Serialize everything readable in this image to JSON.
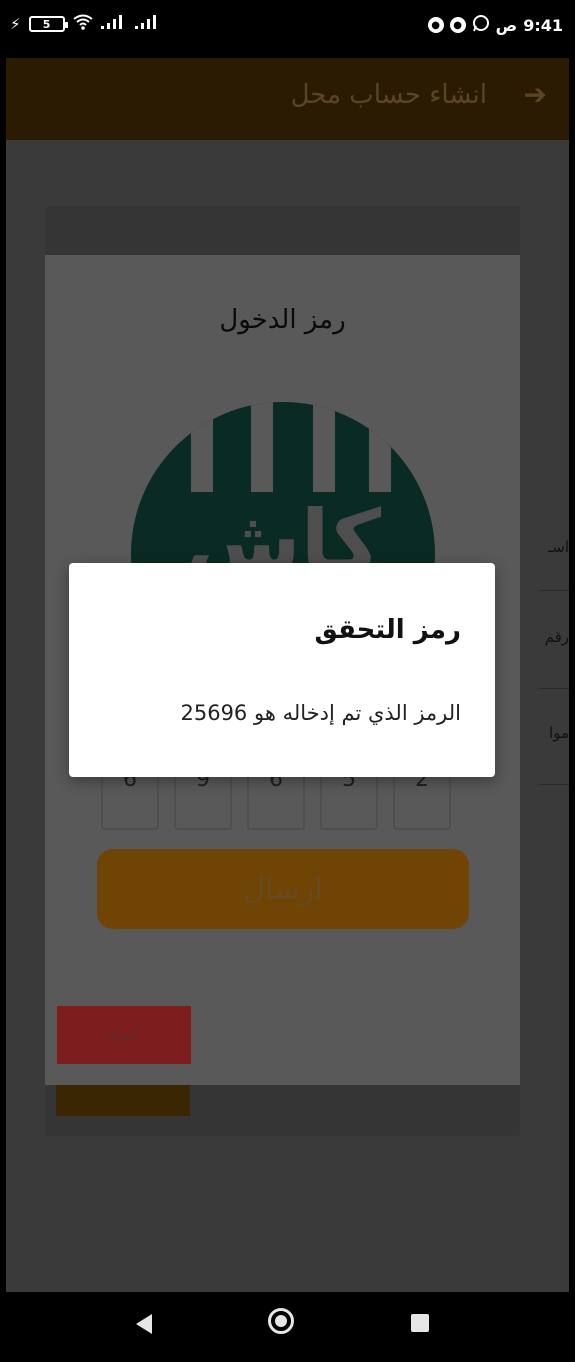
{
  "status_bar": {
    "time": "9:41",
    "period": "ص",
    "battery_level": "5",
    "icons": [
      "charging-icon",
      "battery-icon",
      "wifi-icon",
      "signal-icon",
      "signal-icon",
      "whatsapp-icon",
      "notification-icon",
      "notification-icon"
    ]
  },
  "app_bar": {
    "title": "انشاء حساب محل",
    "back_icon": "arrow-right-icon"
  },
  "background_form": {
    "field_labels_partial": [
      "اسـ",
      "رقم",
      "موا"
    ]
  },
  "code_dialog": {
    "title": "رمز الدخول",
    "logo_text": "كاش",
    "digits": [
      "6",
      "9",
      "6",
      "5",
      "2"
    ],
    "send_label": "ارسال",
    "cancel_label": "الغاء"
  },
  "alert": {
    "title": "رمز التحقق",
    "message": "الرمز الذي تم إدخاله هو 25696"
  },
  "colors": {
    "accent": "#f2a500",
    "brand_green": "#0b5e52",
    "cancel_red": "#e53935",
    "dim_overlay": "#3e3e3e"
  },
  "nav_bar": {
    "buttons": [
      "back-icon",
      "home-icon",
      "recents-icon"
    ]
  }
}
